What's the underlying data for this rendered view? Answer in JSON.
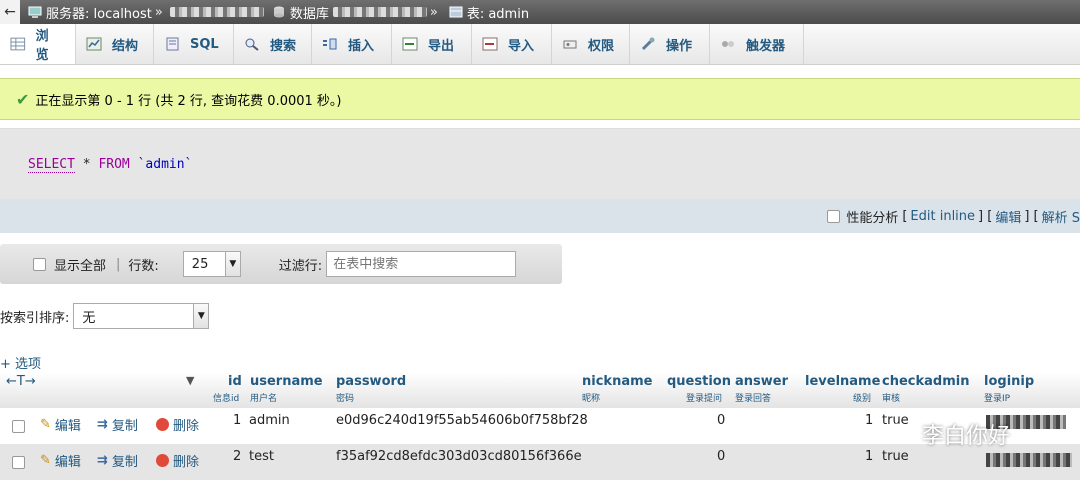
{
  "breadcrumb": {
    "server_label": "服务器: localhost",
    "sep1": "»",
    "database_label": "数据库",
    "sep2": "»",
    "table_label": "表: admin",
    "back_glyph": "←"
  },
  "tabs": [
    {
      "label": "浏览",
      "icon": "browse-icon"
    },
    {
      "label": "结构",
      "icon": "structure-icon"
    },
    {
      "label": "SQL",
      "icon": "sql-icon"
    },
    {
      "label": "搜索",
      "icon": "search-icon"
    },
    {
      "label": "插入",
      "icon": "insert-icon"
    },
    {
      "label": "导出",
      "icon": "export-icon"
    },
    {
      "label": "导入",
      "icon": "import-icon"
    },
    {
      "label": "权限",
      "icon": "privileges-icon"
    },
    {
      "label": "操作",
      "icon": "operations-icon"
    },
    {
      "label": "触发器",
      "icon": "triggers-icon"
    }
  ],
  "success_message": "正在显示第 0 - 1 行 (共 2 行, 查询花费 0.0001 秒。)",
  "sql": {
    "select": "SELECT",
    "star": "*",
    "from": "FROM",
    "table": "`admin`"
  },
  "sql_links": {
    "profiling": "性能分析",
    "open1": "[",
    "edit_inline": "Edit inline",
    "close_open": "] [",
    "edit": "编辑",
    "close_open2": "] [",
    "explain": "解析 S"
  },
  "nav": {
    "show_all": "显示全部",
    "rows_label": "行数:",
    "rows_value": "25",
    "filter_label": "过滤行:",
    "filter_placeholder": "在表中搜索"
  },
  "sort": {
    "label": "按索引排序:",
    "value": "无"
  },
  "options_label": "+ 选项",
  "table": {
    "move_glyph": "←T→",
    "columns": [
      {
        "name": "id",
        "sub": "信息id"
      },
      {
        "name": "username",
        "sub": "用户名"
      },
      {
        "name": "password",
        "sub": "密码"
      },
      {
        "name": "nickname",
        "sub": "昵称"
      },
      {
        "name": "question",
        "sub": "登录提问"
      },
      {
        "name": "answer",
        "sub": "登录回答"
      },
      {
        "name": "levelname",
        "sub": "级别"
      },
      {
        "name": "checkadmin",
        "sub": "审核"
      },
      {
        "name": "loginip",
        "sub": "登录IP"
      }
    ],
    "actions": {
      "edit": "编辑",
      "copy": "复制",
      "delete": "删除"
    },
    "rows": [
      {
        "id": "1",
        "username": "admin",
        "password": "e0d96c240d19f55ab54606b0f758bf28",
        "question": "0",
        "levelname": "1",
        "checkadmin": "true"
      },
      {
        "id": "2",
        "username": "test",
        "password": "f35af92cd8efdc303d03cd80156f366e",
        "question": "0",
        "levelname": "1",
        "checkadmin": "true"
      }
    ]
  },
  "watermark": "李白你好",
  "colors": {
    "link": "#235a81",
    "success_bg": "#ebf8a4",
    "keyword": "#990099"
  }
}
